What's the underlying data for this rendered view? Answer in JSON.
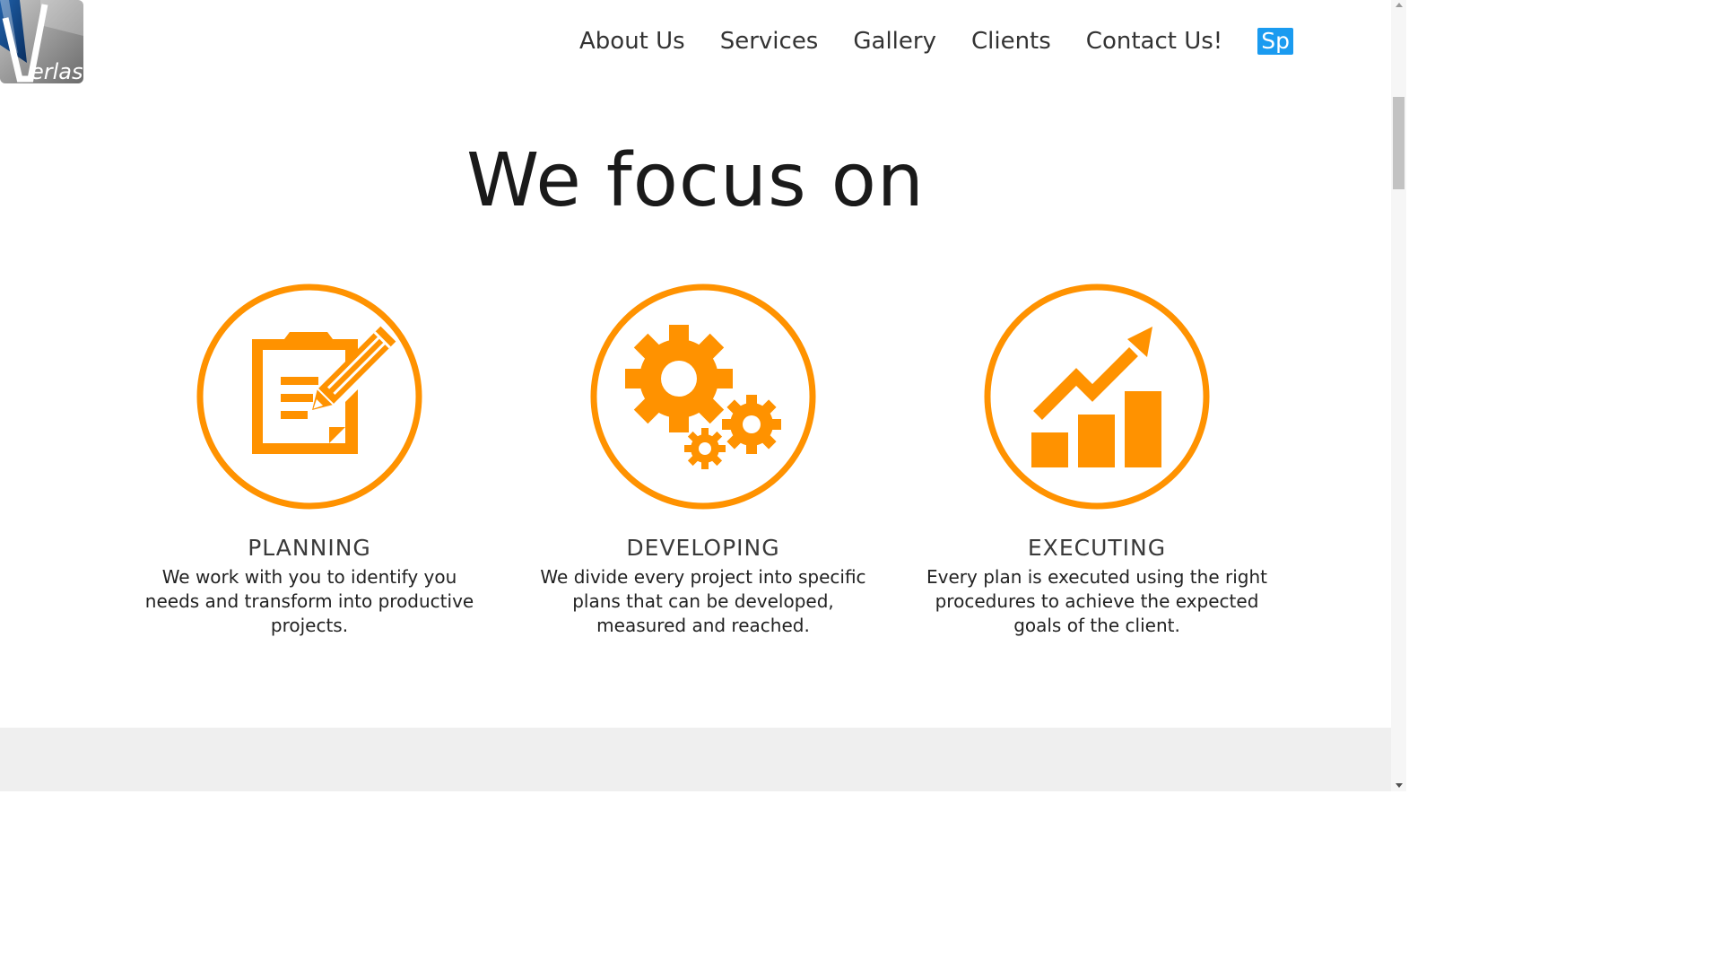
{
  "brand": {
    "logo_text": "erlas",
    "logo_letter": "V"
  },
  "nav": {
    "items": [
      {
        "label": "About Us"
      },
      {
        "label": "Services"
      },
      {
        "label": "Gallery"
      },
      {
        "label": "Clients"
      },
      {
        "label": "Contact Us!"
      }
    ],
    "language_button": "Sp"
  },
  "section": {
    "title": "We focus on"
  },
  "features": [
    {
      "title": "PLANNING",
      "description": "We work with you to identify you needs and transform into productive projects.",
      "icon": "clipboard-pencil-icon"
    },
    {
      "title": "DEVELOPING",
      "description": "We divide every project into specific plans that can be developed, measured and reached.",
      "icon": "gears-icon"
    },
    {
      "title": "EXECUTING",
      "description": "Every plan is executed using the right procedures to achieve the expected goals of the client.",
      "icon": "growth-chart-icon"
    }
  ],
  "colors": {
    "accent": "#ff9200",
    "language_button": "#1a9bf0",
    "footer_band": "#efefef"
  }
}
